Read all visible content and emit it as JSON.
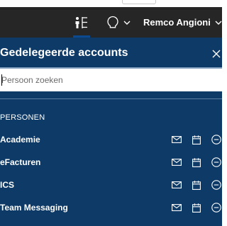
{
  "header": {
    "delegate_icon": "delegate-accounts-icon",
    "help_icon": "lightbulb-help-icon",
    "user_name": "Remco Angioni",
    "accent_color": "#0b4a8f"
  },
  "panel": {
    "title": "Gedelegeerde accounts",
    "close_icon": "close-icon",
    "search": {
      "placeholder": "Persoon zoeken",
      "value": ""
    },
    "section_label": "PERSONEN",
    "background_color": "#0d3a66",
    "persons": [
      {
        "name": "Academie"
      },
      {
        "name": "eFacturen"
      },
      {
        "name": "ICS"
      },
      {
        "name": "Team Messaging"
      }
    ],
    "row_icons": [
      "mail-icon",
      "calendar-icon",
      "remove-icon"
    ]
  }
}
